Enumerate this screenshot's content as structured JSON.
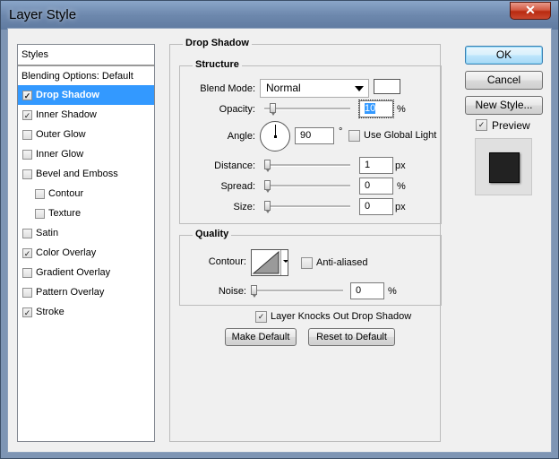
{
  "window": {
    "title": "Layer Style",
    "close_glyph": "✕"
  },
  "styles_list": {
    "header": "Styles",
    "blending_options": "Blending Options: Default",
    "items": [
      {
        "label": "Drop Shadow",
        "checked": true,
        "selected": true,
        "indent": false
      },
      {
        "label": "Inner Shadow",
        "checked": true,
        "selected": false,
        "indent": false
      },
      {
        "label": "Outer Glow",
        "checked": false,
        "selected": false,
        "indent": false
      },
      {
        "label": "Inner Glow",
        "checked": false,
        "selected": false,
        "indent": false
      },
      {
        "label": "Bevel and Emboss",
        "checked": false,
        "selected": false,
        "indent": false
      },
      {
        "label": "Contour",
        "checked": false,
        "selected": false,
        "indent": true
      },
      {
        "label": "Texture",
        "checked": false,
        "selected": false,
        "indent": true
      },
      {
        "label": "Satin",
        "checked": false,
        "selected": false,
        "indent": false
      },
      {
        "label": "Color Overlay",
        "checked": true,
        "selected": false,
        "indent": false
      },
      {
        "label": "Gradient Overlay",
        "checked": false,
        "selected": false,
        "indent": false
      },
      {
        "label": "Pattern Overlay",
        "checked": false,
        "selected": false,
        "indent": false
      },
      {
        "label": "Stroke",
        "checked": true,
        "selected": false,
        "indent": false
      }
    ]
  },
  "drop_shadow": {
    "title": "Drop Shadow",
    "structure": {
      "title": "Structure",
      "blend_mode_label": "Blend Mode:",
      "blend_mode_value": "Normal",
      "shadow_color": "#ffffff",
      "opacity_label": "Opacity:",
      "opacity_value": "10",
      "opacity_unit": "%",
      "angle_label": "Angle:",
      "angle_value": "90",
      "angle_unit": "°",
      "use_global_light_label": "Use Global Light",
      "use_global_light_checked": false,
      "distance_label": "Distance:",
      "distance_value": "1",
      "distance_unit": "px",
      "spread_label": "Spread:",
      "spread_value": "0",
      "spread_unit": "%",
      "size_label": "Size:",
      "size_value": "0",
      "size_unit": "px"
    },
    "quality": {
      "title": "Quality",
      "contour_label": "Contour:",
      "anti_aliased_label": "Anti-aliased",
      "anti_aliased_checked": false,
      "noise_label": "Noise:",
      "noise_value": "0",
      "noise_unit": "%"
    },
    "layer_knocks_out_label": "Layer Knocks Out Drop Shadow",
    "layer_knocks_out_checked": true,
    "make_default_label": "Make Default",
    "reset_to_default_label": "Reset to Default"
  },
  "buttons": {
    "ok": "OK",
    "cancel": "Cancel",
    "new_style": "New Style...",
    "preview_label": "Preview",
    "preview_checked": true
  },
  "colors": {
    "selection": "#3399ff",
    "window_frame": "#7e95b4",
    "close_button": "#c9482f"
  }
}
